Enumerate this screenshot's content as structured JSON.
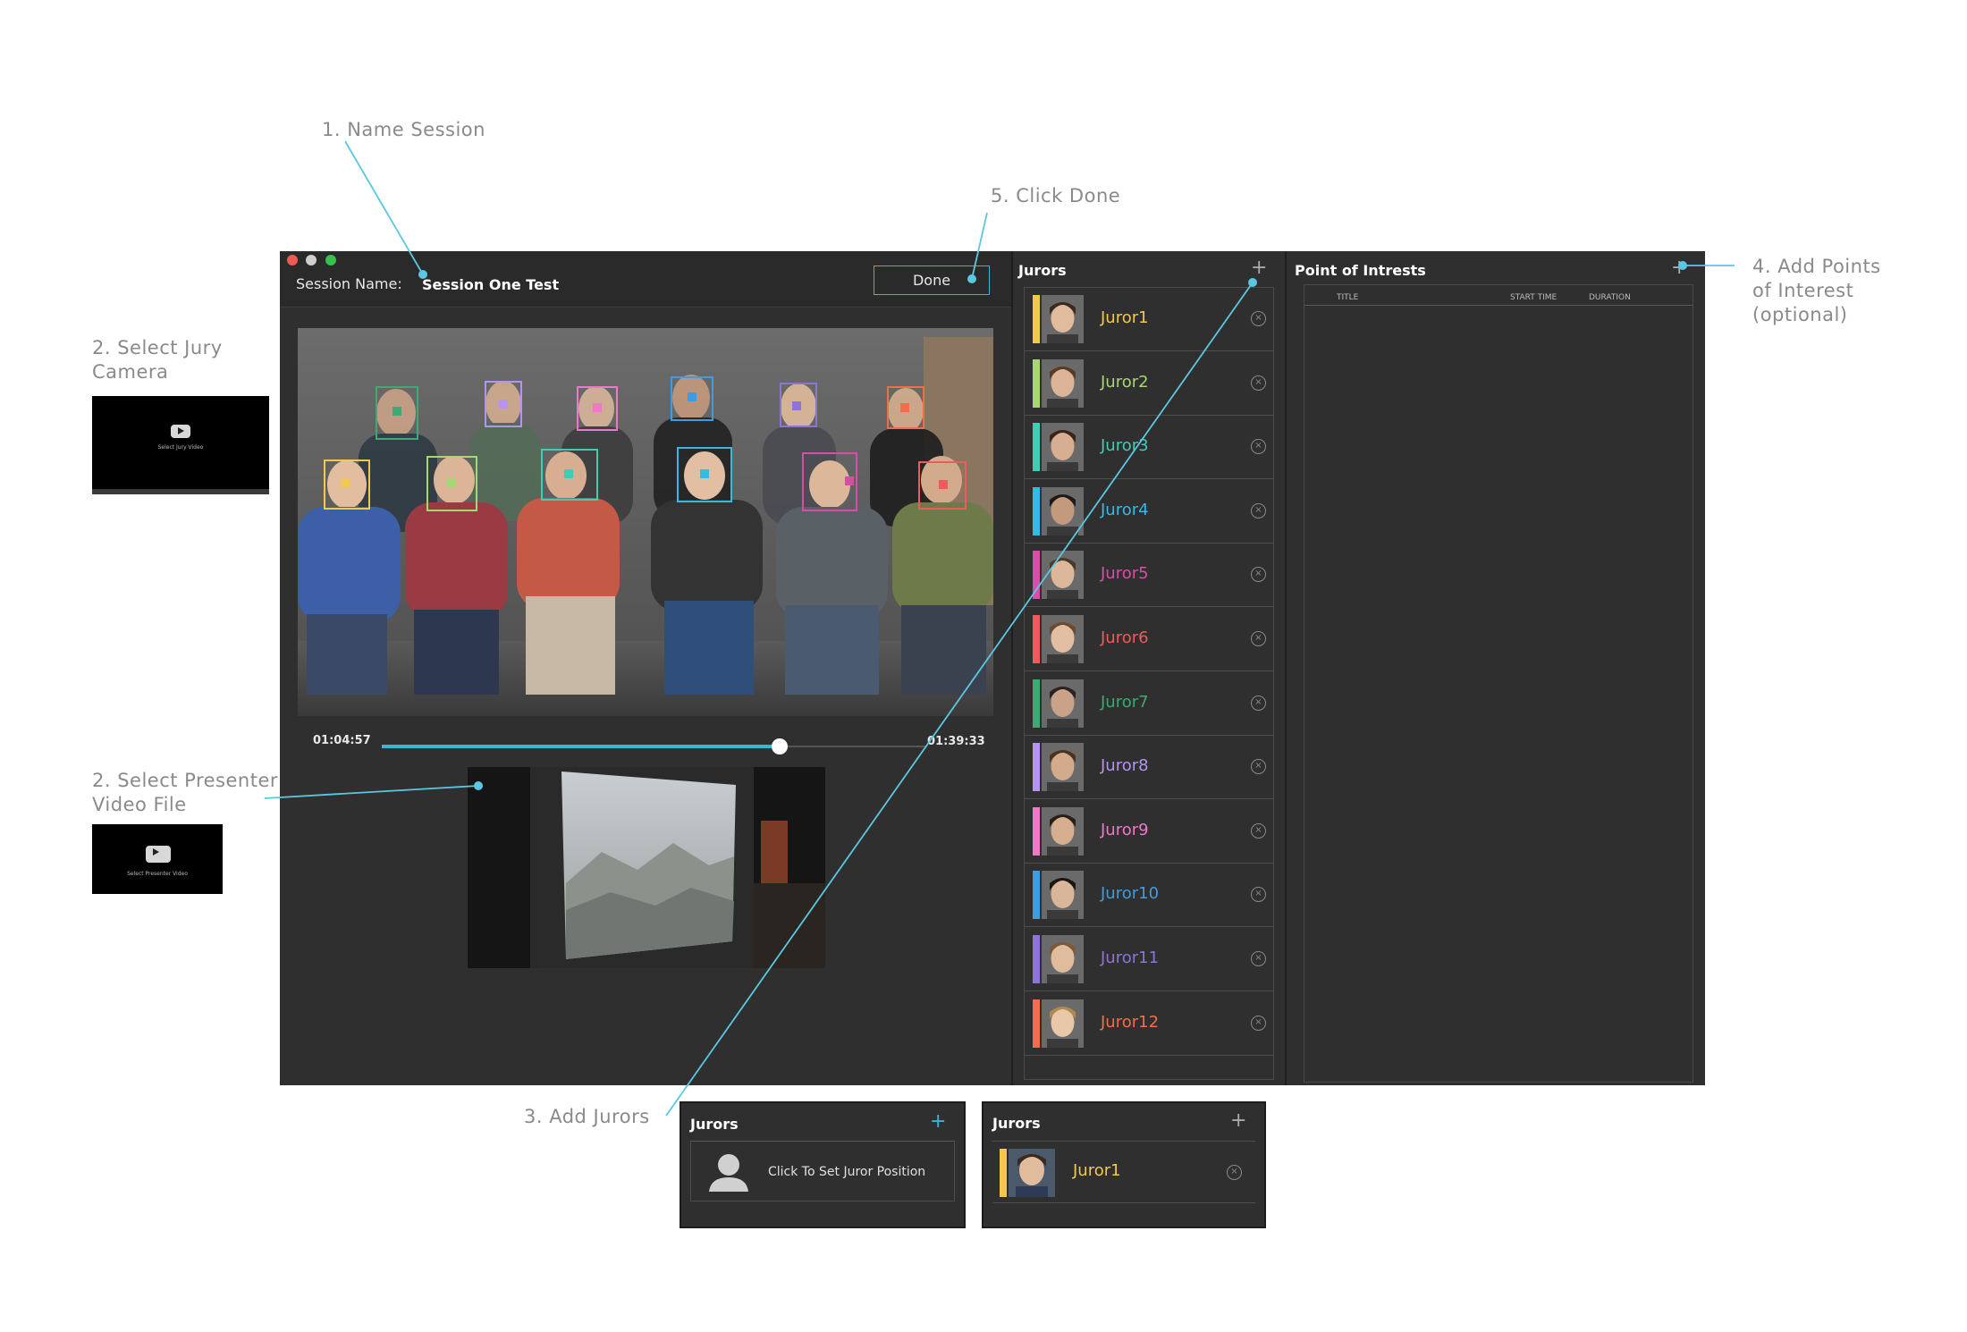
{
  "callouts": {
    "name_session": "1. Name Session",
    "click_done": "5. Click Done",
    "jury_camera_l1": "2. Select Jury",
    "jury_camera_l2": "Camera",
    "presenter_l1": "2. Select Presenter",
    "presenter_l2": "Video File",
    "add_poi_l1": "4. Add Points",
    "add_poi_l2": "of Interest",
    "add_poi_l3": "(optional)",
    "add_jurors": "3. Add Jurors"
  },
  "thumbs": {
    "jury_label": "Select Jury Video",
    "presenter_label": "Select Presenter Video"
  },
  "session": {
    "label": "Session Name:",
    "value": "Session One Test",
    "done_label": "Done"
  },
  "player": {
    "current_time": "01:04:57",
    "total_time": "01:39:33",
    "progress": 0.73
  },
  "jurors_panel": {
    "title": "Jurors",
    "plus": "+",
    "close_glyph": "×",
    "items": [
      {
        "name": "Juror1",
        "color": "#f2c94c"
      },
      {
        "name": "Juror2",
        "color": "#a8d672"
      },
      {
        "name": "Juror3",
        "color": "#3fcdb4"
      },
      {
        "name": "Juror4",
        "color": "#35b9e6"
      },
      {
        "name": "Juror5",
        "color": "#d54fa6"
      },
      {
        "name": "Juror6",
        "color": "#ef5b5b"
      },
      {
        "name": "Juror7",
        "color": "#3fa873"
      },
      {
        "name": "Juror8",
        "color": "#b494f0"
      },
      {
        "name": "Juror9",
        "color": "#ef79c9"
      },
      {
        "name": "Juror10",
        "color": "#3f9ce0"
      },
      {
        "name": "Juror11",
        "color": "#8c74d8"
      },
      {
        "name": "Juror12",
        "color": "#f36d4a"
      }
    ]
  },
  "poi_panel": {
    "title": "Point of Intrests",
    "plus": "+",
    "col_title": "TITLE",
    "col_start": "START TIME",
    "col_duration": "DURATION"
  },
  "mini_empty": {
    "title": "Jurors",
    "plus": "+",
    "placeholder": "Click To Set Juror Position"
  },
  "mini_filled": {
    "title": "Jurors",
    "plus": "+",
    "juror_name": "Juror1",
    "juror_color": "#f2c94c",
    "close_glyph": "×"
  },
  "colors": {
    "accent": "#36b6d8",
    "window_bg": "#2f2f2f"
  }
}
